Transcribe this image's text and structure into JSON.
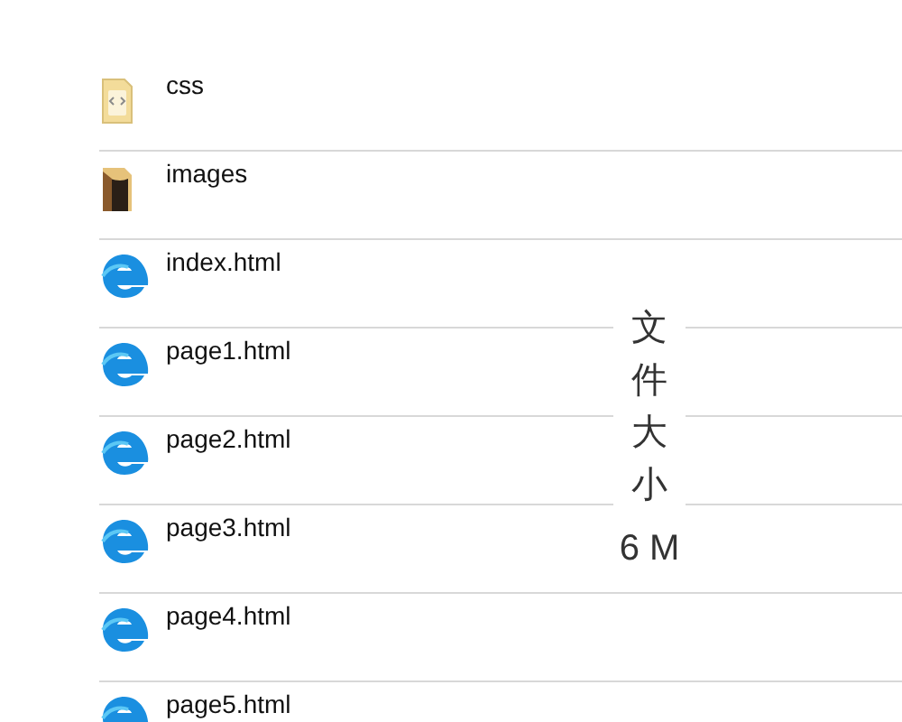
{
  "files": [
    {
      "name": "css",
      "kind": "code"
    },
    {
      "name": "images",
      "kind": "photos"
    },
    {
      "name": "index.html",
      "kind": "web"
    },
    {
      "name": "page1.html",
      "kind": "web"
    },
    {
      "name": "page2.html",
      "kind": "web"
    },
    {
      "name": "page3.html",
      "kind": "web"
    },
    {
      "name": "page4.html",
      "kind": "web"
    },
    {
      "name": "page5.html",
      "kind": "web"
    }
  ],
  "annotation": {
    "label": "文件大小",
    "size": "6 M"
  }
}
